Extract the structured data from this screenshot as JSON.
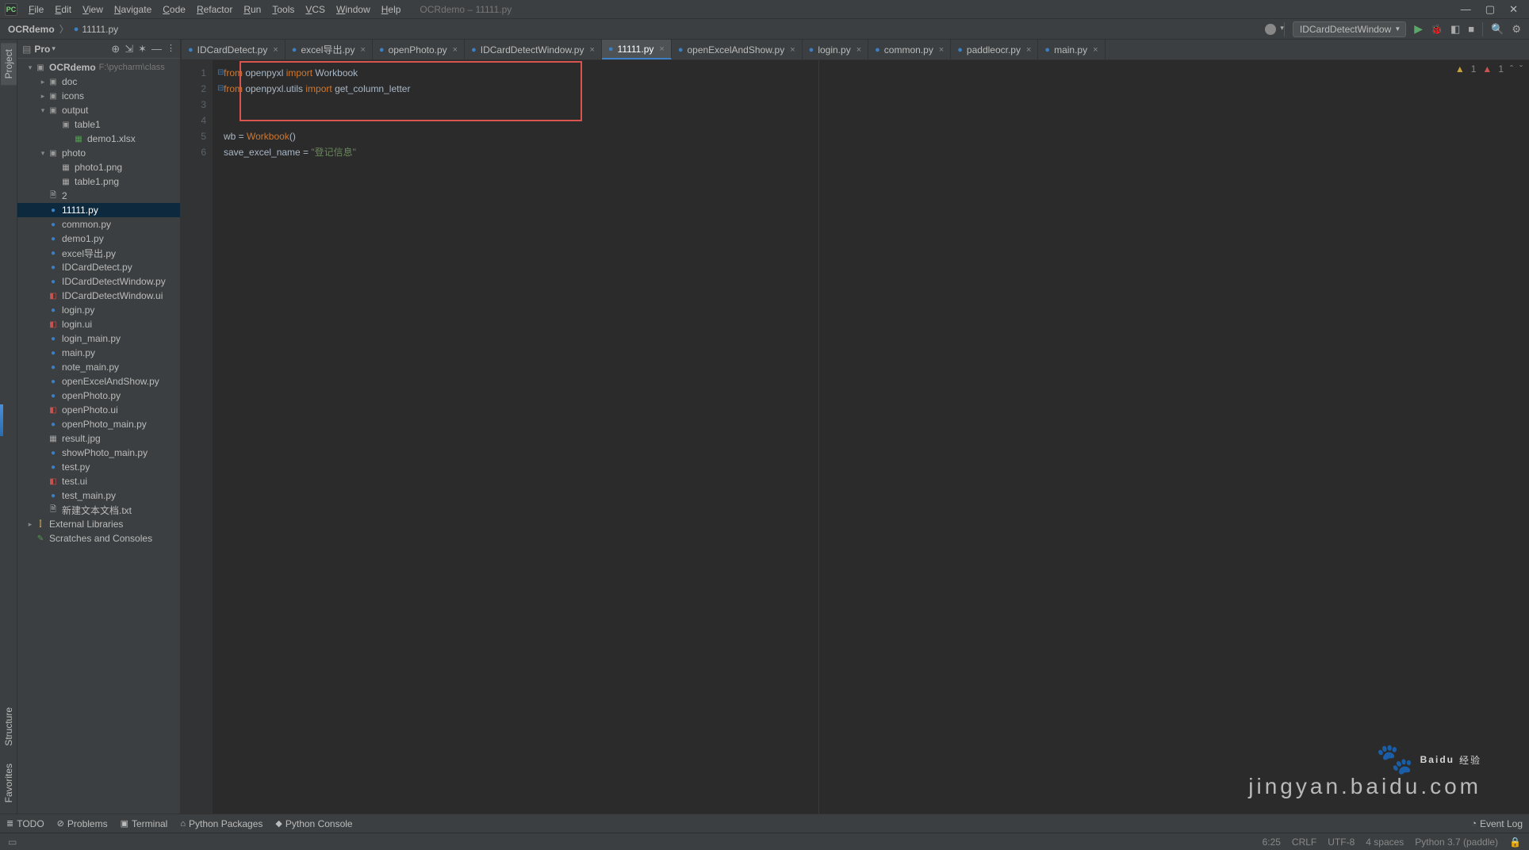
{
  "window": {
    "title": "OCRdemo – 11111.py"
  },
  "menu": [
    "File",
    "Edit",
    "View",
    "Navigate",
    "Code",
    "Refactor",
    "Run",
    "Tools",
    "VCS",
    "Window",
    "Help"
  ],
  "breadcrumb": {
    "project": "OCRdemo",
    "file": "11111.py"
  },
  "runConfig": "IDCardDetectWindow",
  "vtabs": {
    "project": "Project",
    "structure": "Structure",
    "favorites": "Favorites"
  },
  "projectHeader": {
    "title": "Pro",
    "dd": "▾"
  },
  "tree": [
    {
      "d": 0,
      "a": "▾",
      "i": "folder-open",
      "t": "OCRdemo",
      "path": "F:\\pycharm\\class",
      "bold": true
    },
    {
      "d": 1,
      "a": "▸",
      "i": "folder",
      "t": "doc"
    },
    {
      "d": 1,
      "a": "▸",
      "i": "folder",
      "t": "icons"
    },
    {
      "d": 1,
      "a": "▾",
      "i": "folder",
      "t": "output"
    },
    {
      "d": 2,
      "a": "",
      "i": "folder",
      "t": "table1"
    },
    {
      "d": 3,
      "a": "",
      "i": "xl",
      "t": "demo1.xlsx"
    },
    {
      "d": 1,
      "a": "▾",
      "i": "folder",
      "t": "photo"
    },
    {
      "d": 2,
      "a": "",
      "i": "img",
      "t": "photo1.png"
    },
    {
      "d": 2,
      "a": "",
      "i": "img",
      "t": "table1.png"
    },
    {
      "d": 1,
      "a": "",
      "i": "txt",
      "t": "2"
    },
    {
      "d": 1,
      "a": "",
      "i": "py",
      "t": "11111.py",
      "sel": true
    },
    {
      "d": 1,
      "a": "",
      "i": "py",
      "t": "common.py"
    },
    {
      "d": 1,
      "a": "",
      "i": "py",
      "t": "demo1.py"
    },
    {
      "d": 1,
      "a": "",
      "i": "py",
      "t": "excel导出.py"
    },
    {
      "d": 1,
      "a": "",
      "i": "py",
      "t": "IDCardDetect.py"
    },
    {
      "d": 1,
      "a": "",
      "i": "py",
      "t": "IDCardDetectWindow.py"
    },
    {
      "d": 1,
      "a": "",
      "i": "ui",
      "t": "IDCardDetectWindow.ui"
    },
    {
      "d": 1,
      "a": "",
      "i": "py",
      "t": "login.py"
    },
    {
      "d": 1,
      "a": "",
      "i": "ui",
      "t": "login.ui"
    },
    {
      "d": 1,
      "a": "",
      "i": "py",
      "t": "login_main.py"
    },
    {
      "d": 1,
      "a": "",
      "i": "py",
      "t": "main.py"
    },
    {
      "d": 1,
      "a": "",
      "i": "py",
      "t": "note_main.py"
    },
    {
      "d": 1,
      "a": "",
      "i": "py",
      "t": "openExcelAndShow.py"
    },
    {
      "d": 1,
      "a": "",
      "i": "py",
      "t": "openPhoto.py"
    },
    {
      "d": 1,
      "a": "",
      "i": "ui",
      "t": "openPhoto.ui"
    },
    {
      "d": 1,
      "a": "",
      "i": "py",
      "t": "openPhoto_main.py"
    },
    {
      "d": 1,
      "a": "",
      "i": "img",
      "t": "result.jpg"
    },
    {
      "d": 1,
      "a": "",
      "i": "py",
      "t": "showPhoto_main.py"
    },
    {
      "d": 1,
      "a": "",
      "i": "py",
      "t": "test.py"
    },
    {
      "d": 1,
      "a": "",
      "i": "ui",
      "t": "test.ui"
    },
    {
      "d": 1,
      "a": "",
      "i": "py",
      "t": "test_main.py"
    },
    {
      "d": 1,
      "a": "",
      "i": "txt",
      "t": "新建文本文档.txt"
    },
    {
      "d": 0,
      "a": "▸",
      "i": "lib",
      "t": "External Libraries"
    },
    {
      "d": 0,
      "a": "",
      "i": "scratch",
      "t": "Scratches and Consoles"
    }
  ],
  "tabs": [
    {
      "t": "IDCardDetect.py"
    },
    {
      "t": "excel导出.py"
    },
    {
      "t": "openPhoto.py"
    },
    {
      "t": "IDCardDetectWindow.py"
    },
    {
      "t": "11111.py",
      "active": true
    },
    {
      "t": "openExcelAndShow.py"
    },
    {
      "t": "login.py"
    },
    {
      "t": "common.py"
    },
    {
      "t": "paddleocr.py"
    },
    {
      "t": "main.py"
    }
  ],
  "code": {
    "lines": [
      "1",
      "2",
      "3",
      "4",
      "5",
      "6"
    ],
    "l1_kw1": "from",
    "l1_mod": " openpyxl ",
    "l1_kw2": "import",
    "l1_imp": " Workbook",
    "l2_kw1": "from",
    "l2_mod": " openpyxl.utils ",
    "l2_kw2": "import",
    "l2_imp": " get_column_letter",
    "l5_var": "wb = ",
    "l5_cls": "Workbook",
    "l5_par": "()",
    "l6_var": "save_excel_name = ",
    "l6_str": "\"登记信息\""
  },
  "editorStatus": {
    "warn": "1",
    "err": "1"
  },
  "bottomTools": {
    "todo": "TODO",
    "problems": "Problems",
    "terminal": "Terminal",
    "packages": "Python Packages",
    "console": "Python Console",
    "eventlog": "Event Log"
  },
  "statusbar": {
    "pos": "6:25",
    "sep": "CRLF",
    "enc": "UTF-8",
    "indent": "4 spaces",
    "interp": "Python 3.7 (paddle)"
  },
  "watermark": {
    "brand": "Baidu",
    "exp": "经验",
    "url": "jingyan.baidu.com"
  }
}
